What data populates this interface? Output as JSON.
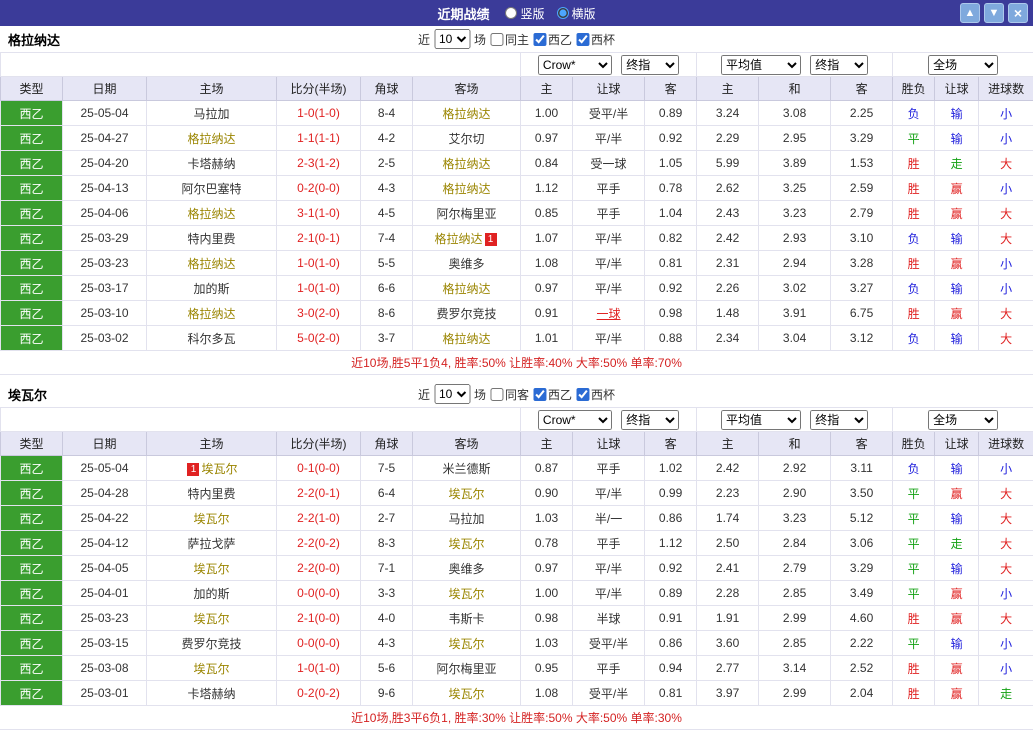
{
  "topbar": {
    "title": "近期战绩",
    "layout_radios": [
      {
        "label": "竖版",
        "checked": false
      },
      {
        "label": "横版",
        "checked": true
      }
    ],
    "up_icon": "▲",
    "down_icon": "▼",
    "close_icon": "×"
  },
  "colors": {
    "topbar_bg": "#3b3b99",
    "league_green": "#3a9e2f",
    "header_bg": "#e6e6f5",
    "score_red": "#e02222",
    "focus_team": "#9a8500",
    "win_red": "#e02222",
    "lose_blue": "#2222dd",
    "draw_green": "#12a012",
    "summary_red": "#d42222"
  },
  "columns": [
    "类型",
    "日期",
    "主场",
    "比分(半场)",
    "角球",
    "客场",
    "主",
    "让球",
    "客",
    "主",
    "和",
    "客",
    "胜负",
    "让球",
    "进球数"
  ],
  "sections": [
    {
      "team": "格拉纳达",
      "filter": {
        "prefix": "近",
        "matches": "10",
        "suffix": "场",
        "checkboxes": [
          {
            "label": "同主",
            "checked": false
          },
          {
            "label": "西乙",
            "checked": true
          },
          {
            "label": "西杯",
            "checked": true
          }
        ]
      },
      "selects": {
        "odds_company": "Crow*",
        "odds_stage": "终指",
        "average": "平均值",
        "average_stage": "终指",
        "scope": "全场"
      },
      "rows": [
        {
          "league": "西乙",
          "date": "25-05-04",
          "home": "马拉加",
          "score": "1-0(1-0)",
          "corners": "8-4",
          "away": "格拉纳达",
          "away_focus": true,
          "odds_h": "1.00",
          "handicap": "受平/半",
          "odds_a": "0.89",
          "avg_h": "3.24",
          "avg_d": "3.08",
          "avg_a": "2.25",
          "result": "负",
          "result_c": "blue",
          "hresult": "输",
          "hresult_c": "blue",
          "goals": "小",
          "goals_c": "blue"
        },
        {
          "league": "西乙",
          "date": "25-04-27",
          "home": "格拉纳达",
          "home_focus": true,
          "score": "1-1(1-1)",
          "corners": "4-2",
          "away": "艾尔切",
          "odds_h": "0.97",
          "handicap": "平/半",
          "odds_a": "0.92",
          "avg_h": "2.29",
          "avg_d": "2.95",
          "avg_a": "3.29",
          "result": "平",
          "result_c": "green",
          "hresult": "输",
          "hresult_c": "blue",
          "goals": "小",
          "goals_c": "blue"
        },
        {
          "league": "西乙",
          "date": "25-04-20",
          "home": "卡塔赫纳",
          "score": "2-3(1-2)",
          "corners": "2-5",
          "away": "格拉纳达",
          "away_focus": true,
          "odds_h": "0.84",
          "handicap": "受一球",
          "odds_a": "1.05",
          "avg_h": "5.99",
          "avg_d": "3.89",
          "avg_a": "1.53",
          "result": "胜",
          "result_c": "red",
          "hresult": "走",
          "hresult_c": "green",
          "goals": "大",
          "goals_c": "red"
        },
        {
          "league": "西乙",
          "date": "25-04-13",
          "home": "阿尔巴塞特",
          "score": "0-2(0-0)",
          "corners": "4-3",
          "away": "格拉纳达",
          "away_focus": true,
          "odds_h": "1.12",
          "handicap": "平手",
          "odds_a": "0.78",
          "avg_h": "2.62",
          "avg_d": "3.25",
          "avg_a": "2.59",
          "result": "胜",
          "result_c": "red",
          "hresult": "赢",
          "hresult_c": "red",
          "goals": "小",
          "goals_c": "blue"
        },
        {
          "league": "西乙",
          "date": "25-04-06",
          "home": "格拉纳达",
          "home_focus": true,
          "score": "3-1(1-0)",
          "corners": "4-5",
          "away": "阿尔梅里亚",
          "odds_h": "0.85",
          "handicap": "平手",
          "odds_a": "1.04",
          "avg_h": "2.43",
          "avg_d": "3.23",
          "avg_a": "2.79",
          "result": "胜",
          "result_c": "red",
          "hresult": "赢",
          "hresult_c": "red",
          "goals": "大",
          "goals_c": "red"
        },
        {
          "league": "西乙",
          "date": "25-03-29",
          "home": "特内里费",
          "score": "2-1(0-1)",
          "corners": "7-4",
          "away": "格拉纳达",
          "away_focus": true,
          "away_badge_after": "1",
          "odds_h": "1.07",
          "handicap": "平/半",
          "odds_a": "0.82",
          "avg_h": "2.42",
          "avg_d": "2.93",
          "avg_a": "3.10",
          "result": "负",
          "result_c": "blue",
          "hresult": "输",
          "hresult_c": "blue",
          "goals": "大",
          "goals_c": "red"
        },
        {
          "league": "西乙",
          "date": "25-03-23",
          "home": "格拉纳达",
          "home_focus": true,
          "score": "1-0(1-0)",
          "corners": "5-5",
          "away": "奥维多",
          "odds_h": "1.08",
          "handicap": "平/半",
          "odds_a": "0.81",
          "avg_h": "2.31",
          "avg_d": "2.94",
          "avg_a": "3.28",
          "result": "胜",
          "result_c": "red",
          "hresult": "赢",
          "hresult_c": "red",
          "goals": "小",
          "goals_c": "blue"
        },
        {
          "league": "西乙",
          "date": "25-03-17",
          "home": "加的斯",
          "score": "1-0(1-0)",
          "corners": "6-6",
          "away": "格拉纳达",
          "away_focus": true,
          "odds_h": "0.97",
          "handicap": "平/半",
          "odds_a": "0.92",
          "avg_h": "2.26",
          "avg_d": "3.02",
          "avg_a": "3.27",
          "result": "负",
          "result_c": "blue",
          "hresult": "输",
          "hresult_c": "blue",
          "goals": "小",
          "goals_c": "blue"
        },
        {
          "league": "西乙",
          "date": "25-03-10",
          "home": "格拉纳达",
          "home_focus": true,
          "score": "3-0(2-0)",
          "corners": "8-6",
          "away": "费罗尔竞技",
          "odds_h": "0.91",
          "handicap": "一球",
          "handicap_hl": true,
          "odds_a": "0.98",
          "avg_h": "1.48",
          "avg_d": "3.91",
          "avg_a": "6.75",
          "result": "胜",
          "result_c": "red",
          "hresult": "赢",
          "hresult_c": "red",
          "goals": "大",
          "goals_c": "red"
        },
        {
          "league": "西乙",
          "date": "25-03-02",
          "home": "科尔多瓦",
          "score": "5-0(2-0)",
          "corners": "3-7",
          "away": "格拉纳达",
          "away_focus": true,
          "odds_h": "1.01",
          "handicap": "平/半",
          "odds_a": "0.88",
          "avg_h": "2.34",
          "avg_d": "3.04",
          "avg_a": "3.12",
          "result": "负",
          "result_c": "blue",
          "hresult": "输",
          "hresult_c": "blue",
          "goals": "大",
          "goals_c": "red"
        }
      ],
      "summary": "近10场,胜5平1负4, 胜率:50% 让胜率:40% 大率:50% 单率:70%"
    },
    {
      "team": "埃瓦尔",
      "filter": {
        "prefix": "近",
        "matches": "10",
        "suffix": "场",
        "checkboxes": [
          {
            "label": "同客",
            "checked": false
          },
          {
            "label": "西乙",
            "checked": true
          },
          {
            "label": "西杯",
            "checked": true
          }
        ]
      },
      "selects": {
        "odds_company": "Crow*",
        "odds_stage": "终指",
        "average": "平均值",
        "average_stage": "终指",
        "scope": "全场"
      },
      "rows": [
        {
          "league": "西乙",
          "date": "25-05-04",
          "home": "埃瓦尔",
          "home_focus": true,
          "home_badge_before": "1",
          "score": "0-1(0-0)",
          "corners": "7-5",
          "away": "米兰德斯",
          "odds_h": "0.87",
          "handicap": "平手",
          "odds_a": "1.02",
          "avg_h": "2.42",
          "avg_d": "2.92",
          "avg_a": "3.11",
          "result": "负",
          "result_c": "blue",
          "hresult": "输",
          "hresult_c": "blue",
          "goals": "小",
          "goals_c": "blue"
        },
        {
          "league": "西乙",
          "date": "25-04-28",
          "home": "特内里费",
          "score": "2-2(0-1)",
          "corners": "6-4",
          "away": "埃瓦尔",
          "away_focus": true,
          "odds_h": "0.90",
          "handicap": "平/半",
          "odds_a": "0.99",
          "avg_h": "2.23",
          "avg_d": "2.90",
          "avg_a": "3.50",
          "result": "平",
          "result_c": "green",
          "hresult": "赢",
          "hresult_c": "red",
          "goals": "大",
          "goals_c": "red"
        },
        {
          "league": "西乙",
          "date": "25-04-22",
          "home": "埃瓦尔",
          "home_focus": true,
          "score": "2-2(1-0)",
          "corners": "2-7",
          "away": "马拉加",
          "odds_h": "1.03",
          "handicap": "半/一",
          "odds_a": "0.86",
          "avg_h": "1.74",
          "avg_d": "3.23",
          "avg_a": "5.12",
          "result": "平",
          "result_c": "green",
          "hresult": "输",
          "hresult_c": "blue",
          "goals": "大",
          "goals_c": "red"
        },
        {
          "league": "西乙",
          "date": "25-04-12",
          "home": "萨拉戈萨",
          "score": "2-2(0-2)",
          "corners": "8-3",
          "away": "埃瓦尔",
          "away_focus": true,
          "odds_h": "0.78",
          "handicap": "平手",
          "odds_a": "1.12",
          "avg_h": "2.50",
          "avg_d": "2.84",
          "avg_a": "3.06",
          "result": "平",
          "result_c": "green",
          "hresult": "走",
          "hresult_c": "green",
          "goals": "大",
          "goals_c": "red"
        },
        {
          "league": "西乙",
          "date": "25-04-05",
          "home": "埃瓦尔",
          "home_focus": true,
          "score": "2-2(0-0)",
          "corners": "7-1",
          "away": "奥维多",
          "odds_h": "0.97",
          "handicap": "平/半",
          "odds_a": "0.92",
          "avg_h": "2.41",
          "avg_d": "2.79",
          "avg_a": "3.29",
          "result": "平",
          "result_c": "green",
          "hresult": "输",
          "hresult_c": "blue",
          "goals": "大",
          "goals_c": "red"
        },
        {
          "league": "西乙",
          "date": "25-04-01",
          "home": "加的斯",
          "score": "0-0(0-0)",
          "corners": "3-3",
          "away": "埃瓦尔",
          "away_focus": true,
          "odds_h": "1.00",
          "handicap": "平/半",
          "odds_a": "0.89",
          "avg_h": "2.28",
          "avg_d": "2.85",
          "avg_a": "3.49",
          "result": "平",
          "result_c": "green",
          "hresult": "赢",
          "hresult_c": "red",
          "goals": "小",
          "goals_c": "blue"
        },
        {
          "league": "西乙",
          "date": "25-03-23",
          "home": "埃瓦尔",
          "home_focus": true,
          "score": "2-1(0-0)",
          "corners": "4-0",
          "away": "韦斯卡",
          "odds_h": "0.98",
          "handicap": "半球",
          "odds_a": "0.91",
          "avg_h": "1.91",
          "avg_d": "2.99",
          "avg_a": "4.60",
          "result": "胜",
          "result_c": "red",
          "hresult": "赢",
          "hresult_c": "red",
          "goals": "大",
          "goals_c": "red"
        },
        {
          "league": "西乙",
          "date": "25-03-15",
          "home": "费罗尔竞技",
          "score": "0-0(0-0)",
          "corners": "4-3",
          "away": "埃瓦尔",
          "away_focus": true,
          "odds_h": "1.03",
          "handicap": "受平/半",
          "odds_a": "0.86",
          "avg_h": "3.60",
          "avg_d": "2.85",
          "avg_a": "2.22",
          "result": "平",
          "result_c": "green",
          "hresult": "输",
          "hresult_c": "blue",
          "goals": "小",
          "goals_c": "blue"
        },
        {
          "league": "西乙",
          "date": "25-03-08",
          "home": "埃瓦尔",
          "home_focus": true,
          "score": "1-0(1-0)",
          "corners": "5-6",
          "away": "阿尔梅里亚",
          "odds_h": "0.95",
          "handicap": "平手",
          "odds_a": "0.94",
          "avg_h": "2.77",
          "avg_d": "3.14",
          "avg_a": "2.52",
          "result": "胜",
          "result_c": "red",
          "hresult": "赢",
          "hresult_c": "red",
          "goals": "小",
          "goals_c": "blue"
        },
        {
          "league": "西乙",
          "date": "25-03-01",
          "home": "卡塔赫纳",
          "score": "0-2(0-2)",
          "corners": "9-6",
          "away": "埃瓦尔",
          "away_focus": true,
          "odds_h": "1.08",
          "handicap": "受平/半",
          "odds_a": "0.81",
          "avg_h": "3.97",
          "avg_d": "2.99",
          "avg_a": "2.04",
          "result": "胜",
          "result_c": "red",
          "hresult": "赢",
          "hresult_c": "red",
          "goals": "走",
          "goals_c": "green"
        }
      ],
      "summary": "近10场,胜3平6负1, 胜率:30% 让胜率:50% 大率:50% 单率:30%"
    }
  ]
}
